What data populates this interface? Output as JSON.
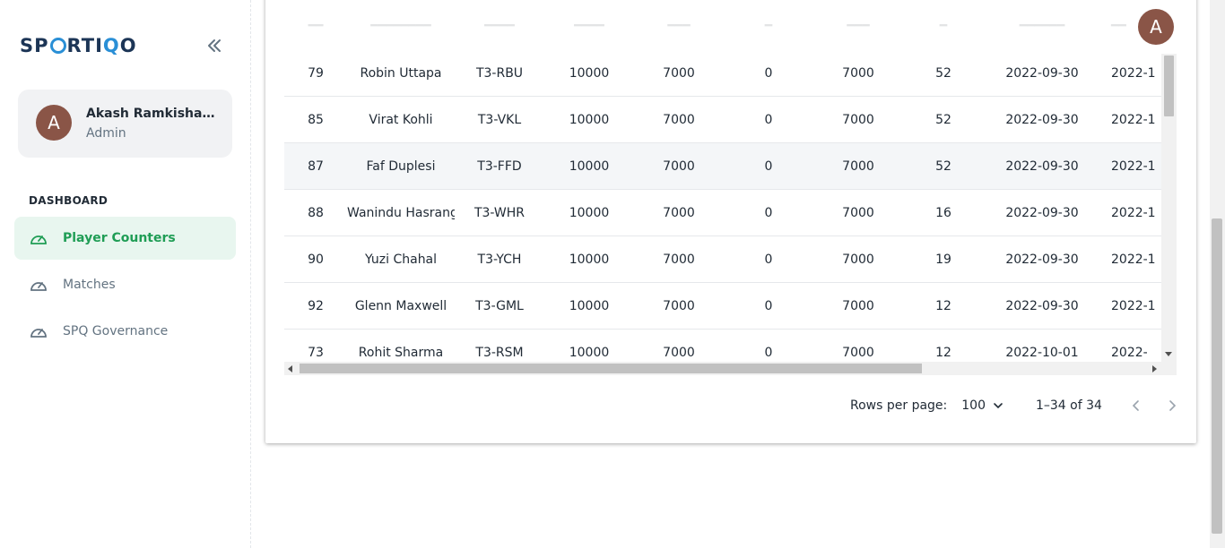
{
  "app": {
    "logo_text_1": "SP",
    "logo_text_2": "RTI",
    "logo_text_3": "Q",
    "logo_text_4": "O",
    "collapse_icon": "double-chevron-left-icon"
  },
  "account": {
    "avatar_letter": "A",
    "name": "Akash Ramkishanra...",
    "role": "Admin"
  },
  "sidebar": {
    "section_title": "DASHBOARD",
    "items": [
      {
        "label": "Player Counters",
        "icon": "speedometer-icon",
        "active": true
      },
      {
        "label": "Matches",
        "icon": "speedometer-icon",
        "active": false
      },
      {
        "label": "SPQ Governance",
        "icon": "speedometer-icon",
        "active": false
      }
    ]
  },
  "table": {
    "rows": [
      [
        "79",
        "Robin Uttapa",
        "T3-RBU",
        "10000",
        "7000",
        "0",
        "7000",
        "52",
        "2022-09-30",
        "2022-1"
      ],
      [
        "85",
        "Virat Kohli",
        "T3-VKL",
        "10000",
        "7000",
        "0",
        "7000",
        "52",
        "2022-09-30",
        "2022-1"
      ],
      [
        "87",
        "Faf Duplesi",
        "T3-FFD",
        "10000",
        "7000",
        "0",
        "7000",
        "52",
        "2022-09-30",
        "2022-1"
      ],
      [
        "88",
        "Wanindu Hasranga",
        "T3-WHR",
        "10000",
        "7000",
        "0",
        "7000",
        "16",
        "2022-09-30",
        "2022-1"
      ],
      [
        "90",
        "Yuzi Chahal",
        "T3-YCH",
        "10000",
        "7000",
        "0",
        "7000",
        "19",
        "2022-09-30",
        "2022-1"
      ],
      [
        "92",
        "Glenn Maxwell",
        "T3-GML",
        "10000",
        "7000",
        "0",
        "7000",
        "12",
        "2022-09-30",
        "2022-1"
      ],
      [
        "73",
        "Rohit Sharma",
        "T3-RSM",
        "10000",
        "7000",
        "0",
        "7000",
        "12",
        "2022-10-01",
        "2022-"
      ]
    ],
    "highlighted_row": 2
  },
  "pagination": {
    "rows_per_page_label": "Rows per page:",
    "rows_per_page_value": "100",
    "range_text": "1–34 of 34"
  },
  "topbar": {
    "avatar_letter": "A"
  },
  "colors": {
    "accent": "#1f9d55",
    "active_bg": "#e8f6ef",
    "avatar": "#8a5547",
    "logo_dark": "#1c3556",
    "logo_blue": "#2a8fd6"
  }
}
